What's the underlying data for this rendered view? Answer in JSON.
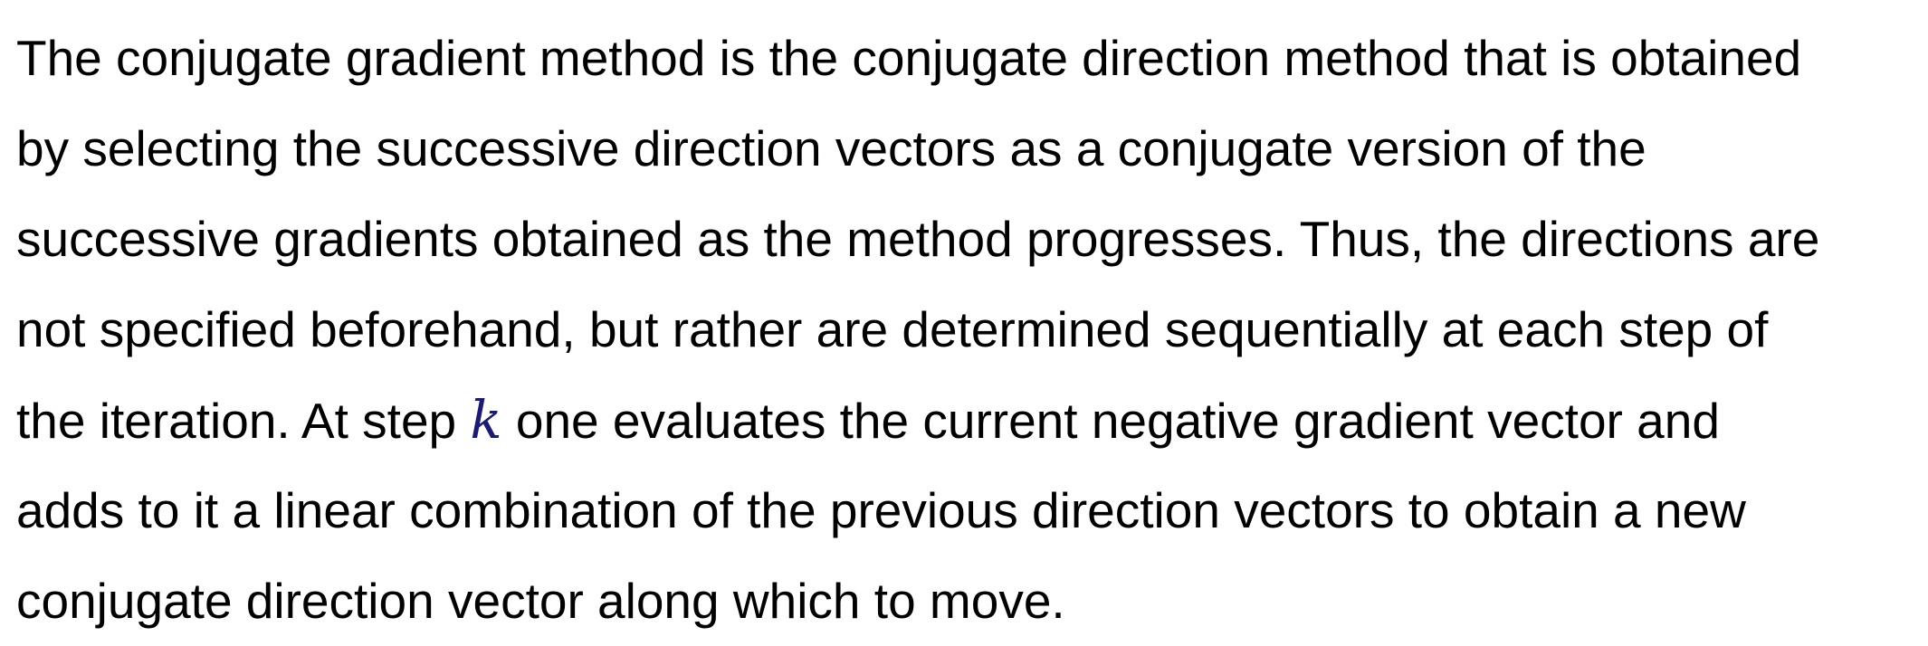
{
  "paragraph": {
    "line1": "The conjugate gradient method is the conjugate direction method that is obtained",
    "line2": "by selecting the successive direction vectors as a conjugate version of the",
    "line3": "successive gradients obtained as the method progresses. Thus, the directions are",
    "line4": "not specified beforehand, but rather are determined sequentially at each step of",
    "line5_before": "the iteration. At step ",
    "line5_math": "k",
    "line5_after": " one evaluates the current negative gradient vector and",
    "line6": "adds to it a linear combination of the previous direction vectors to obtain a new",
    "line7": "conjugate direction vector along which to move."
  },
  "colors": {
    "text": "#000000",
    "math": "#1a1a78",
    "background": "#ffffff"
  }
}
